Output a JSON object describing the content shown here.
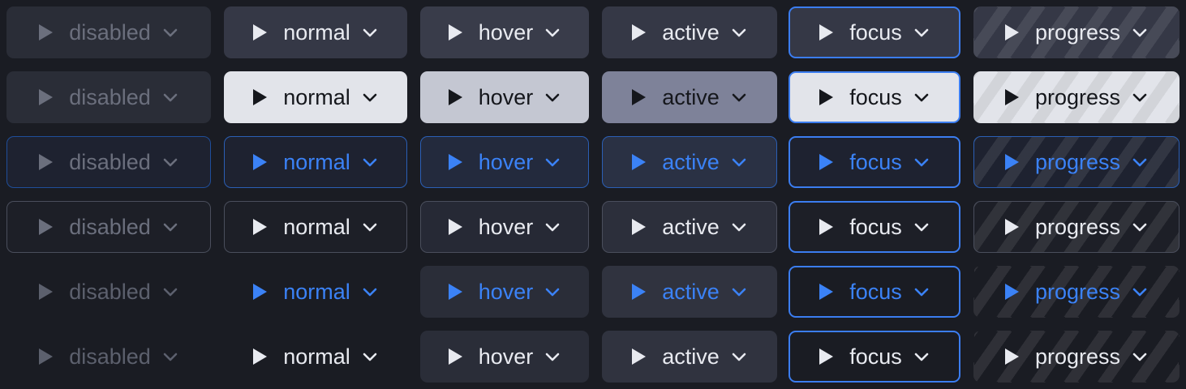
{
  "labels": {
    "disabled": "disabled",
    "normal": "normal",
    "hover": "hover",
    "active": "active",
    "focus": "focus",
    "progress": "progress"
  },
  "icons": {
    "leading": "play-icon",
    "trailing": "chevron-down-icon"
  },
  "colors": {
    "page_background": "#1a1c23",
    "accent_blue": "#3b82f6",
    "focus_ring": "#3b7df0",
    "primary_light": "#e2e4ea",
    "primary_hover": "#c4c7d2",
    "primary_active": "#7e8299",
    "disabled_text": "#6b6f7d",
    "button_dark": "#2e313e",
    "text_light": "#e8eaf0"
  },
  "variants": [
    "default",
    "primary",
    "accent-outline",
    "outline",
    "accent-flat",
    "flat"
  ],
  "states": [
    "disabled",
    "normal",
    "hover",
    "active",
    "focus",
    "progress"
  ]
}
